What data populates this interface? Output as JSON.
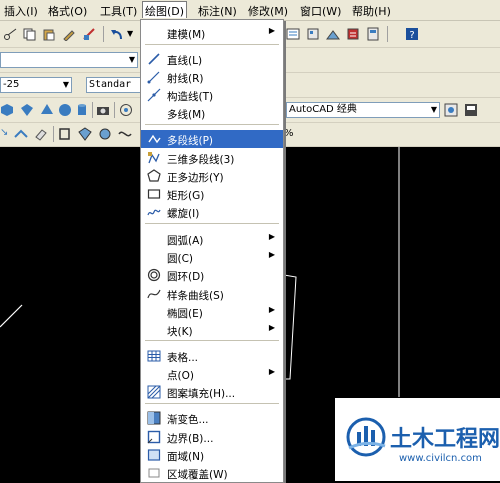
{
  "menubar": {
    "items": [
      "插入(I)",
      "格式(O)",
      "工具(T)",
      "绘图(D)",
      "标注(N)",
      "修改(M)",
      "窗口(W)",
      "帮助(H)"
    ]
  },
  "toolbar": {
    "layer_combo": "-25",
    "style_combo": "Standar",
    "workspace_combo": "AutoCAD 经典",
    "percent_tail": "%"
  },
  "draw_menu": {
    "items": [
      {
        "label": "建模(M)",
        "icon": "none",
        "submenu": true
      },
      {
        "label": "直线(L)",
        "icon": "line-icon"
      },
      {
        "label": "射线(R)",
        "icon": "ray-icon"
      },
      {
        "label": "构造线(T)",
        "icon": "construction-line-icon"
      },
      {
        "label": "多线(M)",
        "icon": "none"
      },
      {
        "label": "多段线(P)",
        "icon": "polyline-icon",
        "highlighted": true
      },
      {
        "label": "三维多段线(3)",
        "icon": "3d-polyline-icon"
      },
      {
        "label": "正多边形(Y)",
        "icon": "polygon-icon"
      },
      {
        "label": "矩形(G)",
        "icon": "rectangle-icon"
      },
      {
        "label": "螺旋(I)",
        "icon": "helix-icon"
      },
      {
        "label": "圆弧(A)",
        "icon": "none",
        "submenu": true
      },
      {
        "label": "圆(C)",
        "icon": "none",
        "submenu": true
      },
      {
        "label": "圆环(D)",
        "icon": "donut-icon"
      },
      {
        "label": "样条曲线(S)",
        "icon": "spline-icon"
      },
      {
        "label": "椭圆(E)",
        "icon": "none",
        "submenu": true
      },
      {
        "label": "块(K)",
        "icon": "none",
        "submenu": true
      },
      {
        "label": "表格...",
        "icon": "table-icon"
      },
      {
        "label": "点(O)",
        "icon": "none",
        "submenu": true
      },
      {
        "label": "图案填充(H)...",
        "icon": "hatch-icon"
      },
      {
        "label": "渐变色...",
        "icon": "gradient-icon"
      },
      {
        "label": "边界(B)...",
        "icon": "boundary-icon"
      },
      {
        "label": "面域(N)",
        "icon": "region-icon"
      },
      {
        "label": "区域覆盖(W)",
        "icon": "wipeout-icon"
      }
    ]
  },
  "watermark": {
    "title": "土木工程网",
    "url": "www.civilcn.com"
  },
  "colors": {
    "menubar_bg": "#ece9d8",
    "highlight": "#316ac5",
    "canvas": "#000000",
    "watermark_blue": "#1b5fae"
  }
}
